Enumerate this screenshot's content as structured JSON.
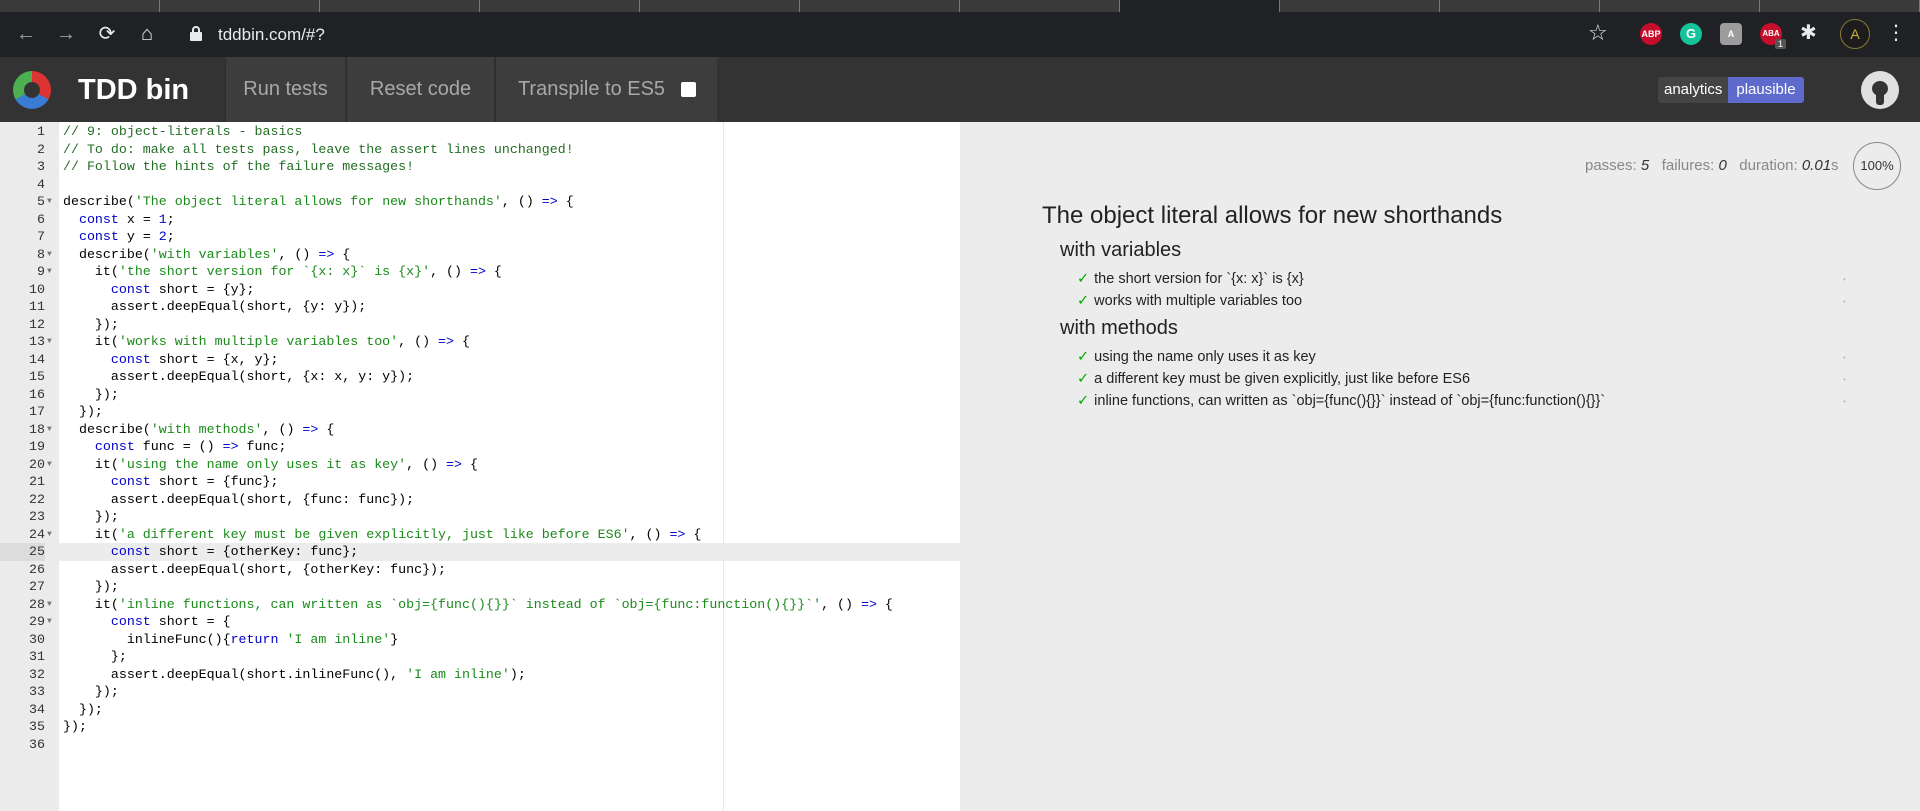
{
  "browser": {
    "url": "tddbin.com/#?",
    "back_icon": "←",
    "forward_icon": "→",
    "reload_icon": "⟳",
    "home_icon": "⌂",
    "star_icon": "☆",
    "ext_abp": "ABP",
    "ext_grammarly": "G",
    "ext_a": "A",
    "ext_aba": "ABA",
    "ext_badge": "1",
    "puzzle_icon": "✱",
    "menu_icon": "⋮"
  },
  "app": {
    "brand": "TDD bin",
    "run_tests": "Run tests",
    "reset_code": "Reset code",
    "transpile": "Transpile to ES5",
    "analytics_label": "analytics",
    "analytics_provider": "plausible"
  },
  "editor": {
    "active_line": 25,
    "lines": [
      {
        "n": "1",
        "fold": false,
        "html": "<span class=\"c\">// 9: object-literals - basics</span>"
      },
      {
        "n": "2",
        "fold": false,
        "html": "<span class=\"c\">// To do: make all tests pass, leave the assert lines unchanged!</span>"
      },
      {
        "n": "3",
        "fold": false,
        "html": "<span class=\"c\">// Follow the hints of the failure messages!</span>"
      },
      {
        "n": "4",
        "fold": false,
        "html": ""
      },
      {
        "n": "5",
        "fold": true,
        "html": "describe(<span class=\"str\">'The object literal allows for new shorthands'</span>, () <span class=\"kw\">=&gt;</span> {"
      },
      {
        "n": "6",
        "fold": false,
        "html": "  <span class=\"kw\">const</span> x = <span class=\"num\">1</span>;"
      },
      {
        "n": "7",
        "fold": false,
        "html": "  <span class=\"kw\">const</span> y = <span class=\"num\">2</span>;"
      },
      {
        "n": "8",
        "fold": true,
        "html": "  describe(<span class=\"str\">'with variables'</span>, () <span class=\"kw\">=&gt;</span> {"
      },
      {
        "n": "9",
        "fold": true,
        "html": "    it(<span class=\"str\">'the short version for `{x: x}` is {x}'</span>, () <span class=\"kw\">=&gt;</span> {"
      },
      {
        "n": "10",
        "fold": false,
        "html": "      <span class=\"kw\">const</span> short = {y};"
      },
      {
        "n": "11",
        "fold": false,
        "html": "      assert.deepEqual(short, {y: y});"
      },
      {
        "n": "12",
        "fold": false,
        "html": "    });"
      },
      {
        "n": "13",
        "fold": true,
        "html": "    it(<span class=\"str\">'works with multiple variables too'</span>, () <span class=\"kw\">=&gt;</span> {"
      },
      {
        "n": "14",
        "fold": false,
        "html": "      <span class=\"kw\">const</span> short = {x, y};"
      },
      {
        "n": "15",
        "fold": false,
        "html": "      assert.deepEqual(short, {x: x, y: y});"
      },
      {
        "n": "16",
        "fold": false,
        "html": "    });"
      },
      {
        "n": "17",
        "fold": false,
        "html": "  });"
      },
      {
        "n": "18",
        "fold": true,
        "html": "  describe(<span class=\"str\">'with methods'</span>, () <span class=\"kw\">=&gt;</span> {"
      },
      {
        "n": "19",
        "fold": false,
        "html": "    <span class=\"kw\">const</span> func = () <span class=\"kw\">=&gt;</span> func;"
      },
      {
        "n": "20",
        "fold": true,
        "html": "    it(<span class=\"str\">'using the name only uses it as key'</span>, () <span class=\"kw\">=&gt;</span> {"
      },
      {
        "n": "21",
        "fold": false,
        "html": "      <span class=\"kw\">const</span> short = {func};"
      },
      {
        "n": "22",
        "fold": false,
        "html": "      assert.deepEqual(short, {func: func});"
      },
      {
        "n": "23",
        "fold": false,
        "html": "    });"
      },
      {
        "n": "24",
        "fold": true,
        "html": "    it(<span class=\"str\">'a different key must be given explicitly, just like before ES6'</span>, () <span class=\"kw\">=&gt;</span> {"
      },
      {
        "n": "25",
        "fold": false,
        "html": "      <span class=\"kw\">const</span> short = {otherKey: func};"
      },
      {
        "n": "26",
        "fold": false,
        "html": "      assert.deepEqual(short, {otherKey: func});"
      },
      {
        "n": "27",
        "fold": false,
        "html": "    });"
      },
      {
        "n": "28",
        "fold": true,
        "html": "    it(<span class=\"str\">'inline functions, can written as `obj={func(){}}` instead of `obj={func:function(){}}`'</span>, () <span class=\"kw\">=&gt;</span> {"
      },
      {
        "n": "29",
        "fold": true,
        "html": "      <span class=\"kw\">const</span> short = {"
      },
      {
        "n": "30",
        "fold": false,
        "html": "        inlineFunc(){<span class=\"kw\">return</span> <span class=\"str\">'I am inline'</span>}"
      },
      {
        "n": "31",
        "fold": false,
        "html": "      };"
      },
      {
        "n": "32",
        "fold": false,
        "html": "      assert.deepEqual(short.inlineFunc(), <span class=\"str\">'I am inline'</span>);"
      },
      {
        "n": "33",
        "fold": false,
        "html": "    });"
      },
      {
        "n": "34",
        "fold": false,
        "html": "  });"
      },
      {
        "n": "35",
        "fold": false,
        "html": "});"
      },
      {
        "n": "36",
        "fold": false,
        "html": ""
      }
    ]
  },
  "results": {
    "passes_label": "passes:",
    "passes": "5",
    "failures_label": "failures:",
    "failures": "0",
    "duration_label": "duration:",
    "duration": "0.01",
    "duration_unit": "s",
    "progress": "100%",
    "suite": "The object literal allows for new shorthands",
    "groups": [
      {
        "title": "with variables",
        "tests": [
          "the short version for `{x: x}` is {x}",
          "works with multiple variables too"
        ]
      },
      {
        "title": "with methods",
        "tests": [
          "using the name only uses it as key",
          "a different key must be given explicitly, just like before ES6",
          "inline functions, can written as `obj={func(){}}` instead of `obj={func:function(){}}`"
        ]
      }
    ]
  }
}
